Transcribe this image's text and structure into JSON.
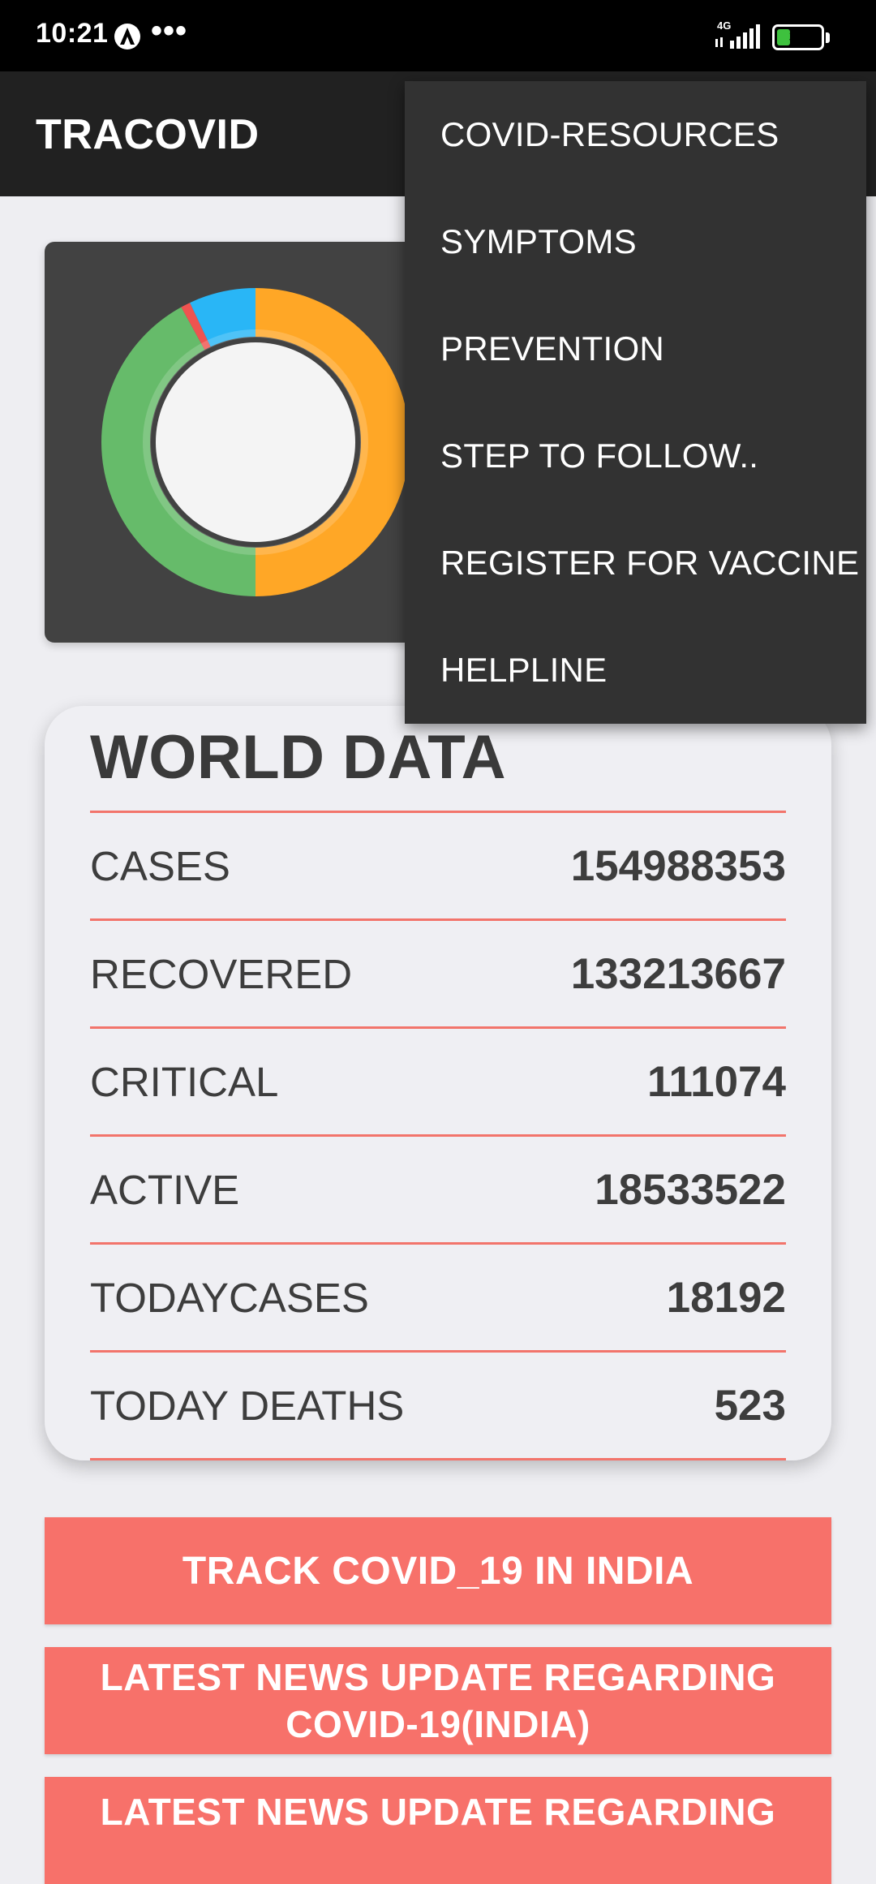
{
  "status_bar": {
    "time": "10:21",
    "dots": "•••",
    "network": "4G",
    "battery": "30",
    "battery_level": 0.3
  },
  "app_bar": {
    "title": "TRACOVID"
  },
  "chart": {
    "colors": [
      "#ffa726",
      "#66bb6a",
      "#ef5350",
      "#29b6f6"
    ],
    "segments": [
      {
        "color": "#ffa726",
        "fraction": 0.5
      },
      {
        "color": "#66bb6a",
        "fraction": 0.42
      },
      {
        "color": "#ef5350",
        "fraction": 0.01
      },
      {
        "color": "#29b6f6",
        "fraction": 0.07
      }
    ]
  },
  "menu": {
    "items": [
      {
        "label": "COVID-RESOURCES"
      },
      {
        "label": "SYMPTOMS"
      },
      {
        "label": "PREVENTION"
      },
      {
        "label": "STEP TO FOLLOW.."
      },
      {
        "label": "REGISTER FOR VACCINE"
      },
      {
        "label": "HELPLINE"
      }
    ]
  },
  "world": {
    "title": "WORLD DATA",
    "rows": [
      {
        "label": "CASES",
        "value": "154988353"
      },
      {
        "label": "RECOVERED",
        "value": "133213667"
      },
      {
        "label": "CRITICAL",
        "value": "111074"
      },
      {
        "label": "ACTIVE",
        "value": "18533522"
      },
      {
        "label": "TODAYCASES",
        "value": "18192"
      },
      {
        "label": "TODAY DEATHS",
        "value": "523"
      }
    ]
  },
  "buttons": {
    "track_india": "TRACK COVID_19 IN INDIA",
    "news_india": "LATEST NEWS UPDATE REGARDING COVID-19(INDIA)",
    "news_world": "LATEST NEWS UPDATE REGARDING"
  },
  "colors": {
    "accent": "#f7716a",
    "divider": "#f2746b",
    "app_bar": "#212121",
    "menu": "#323232"
  }
}
